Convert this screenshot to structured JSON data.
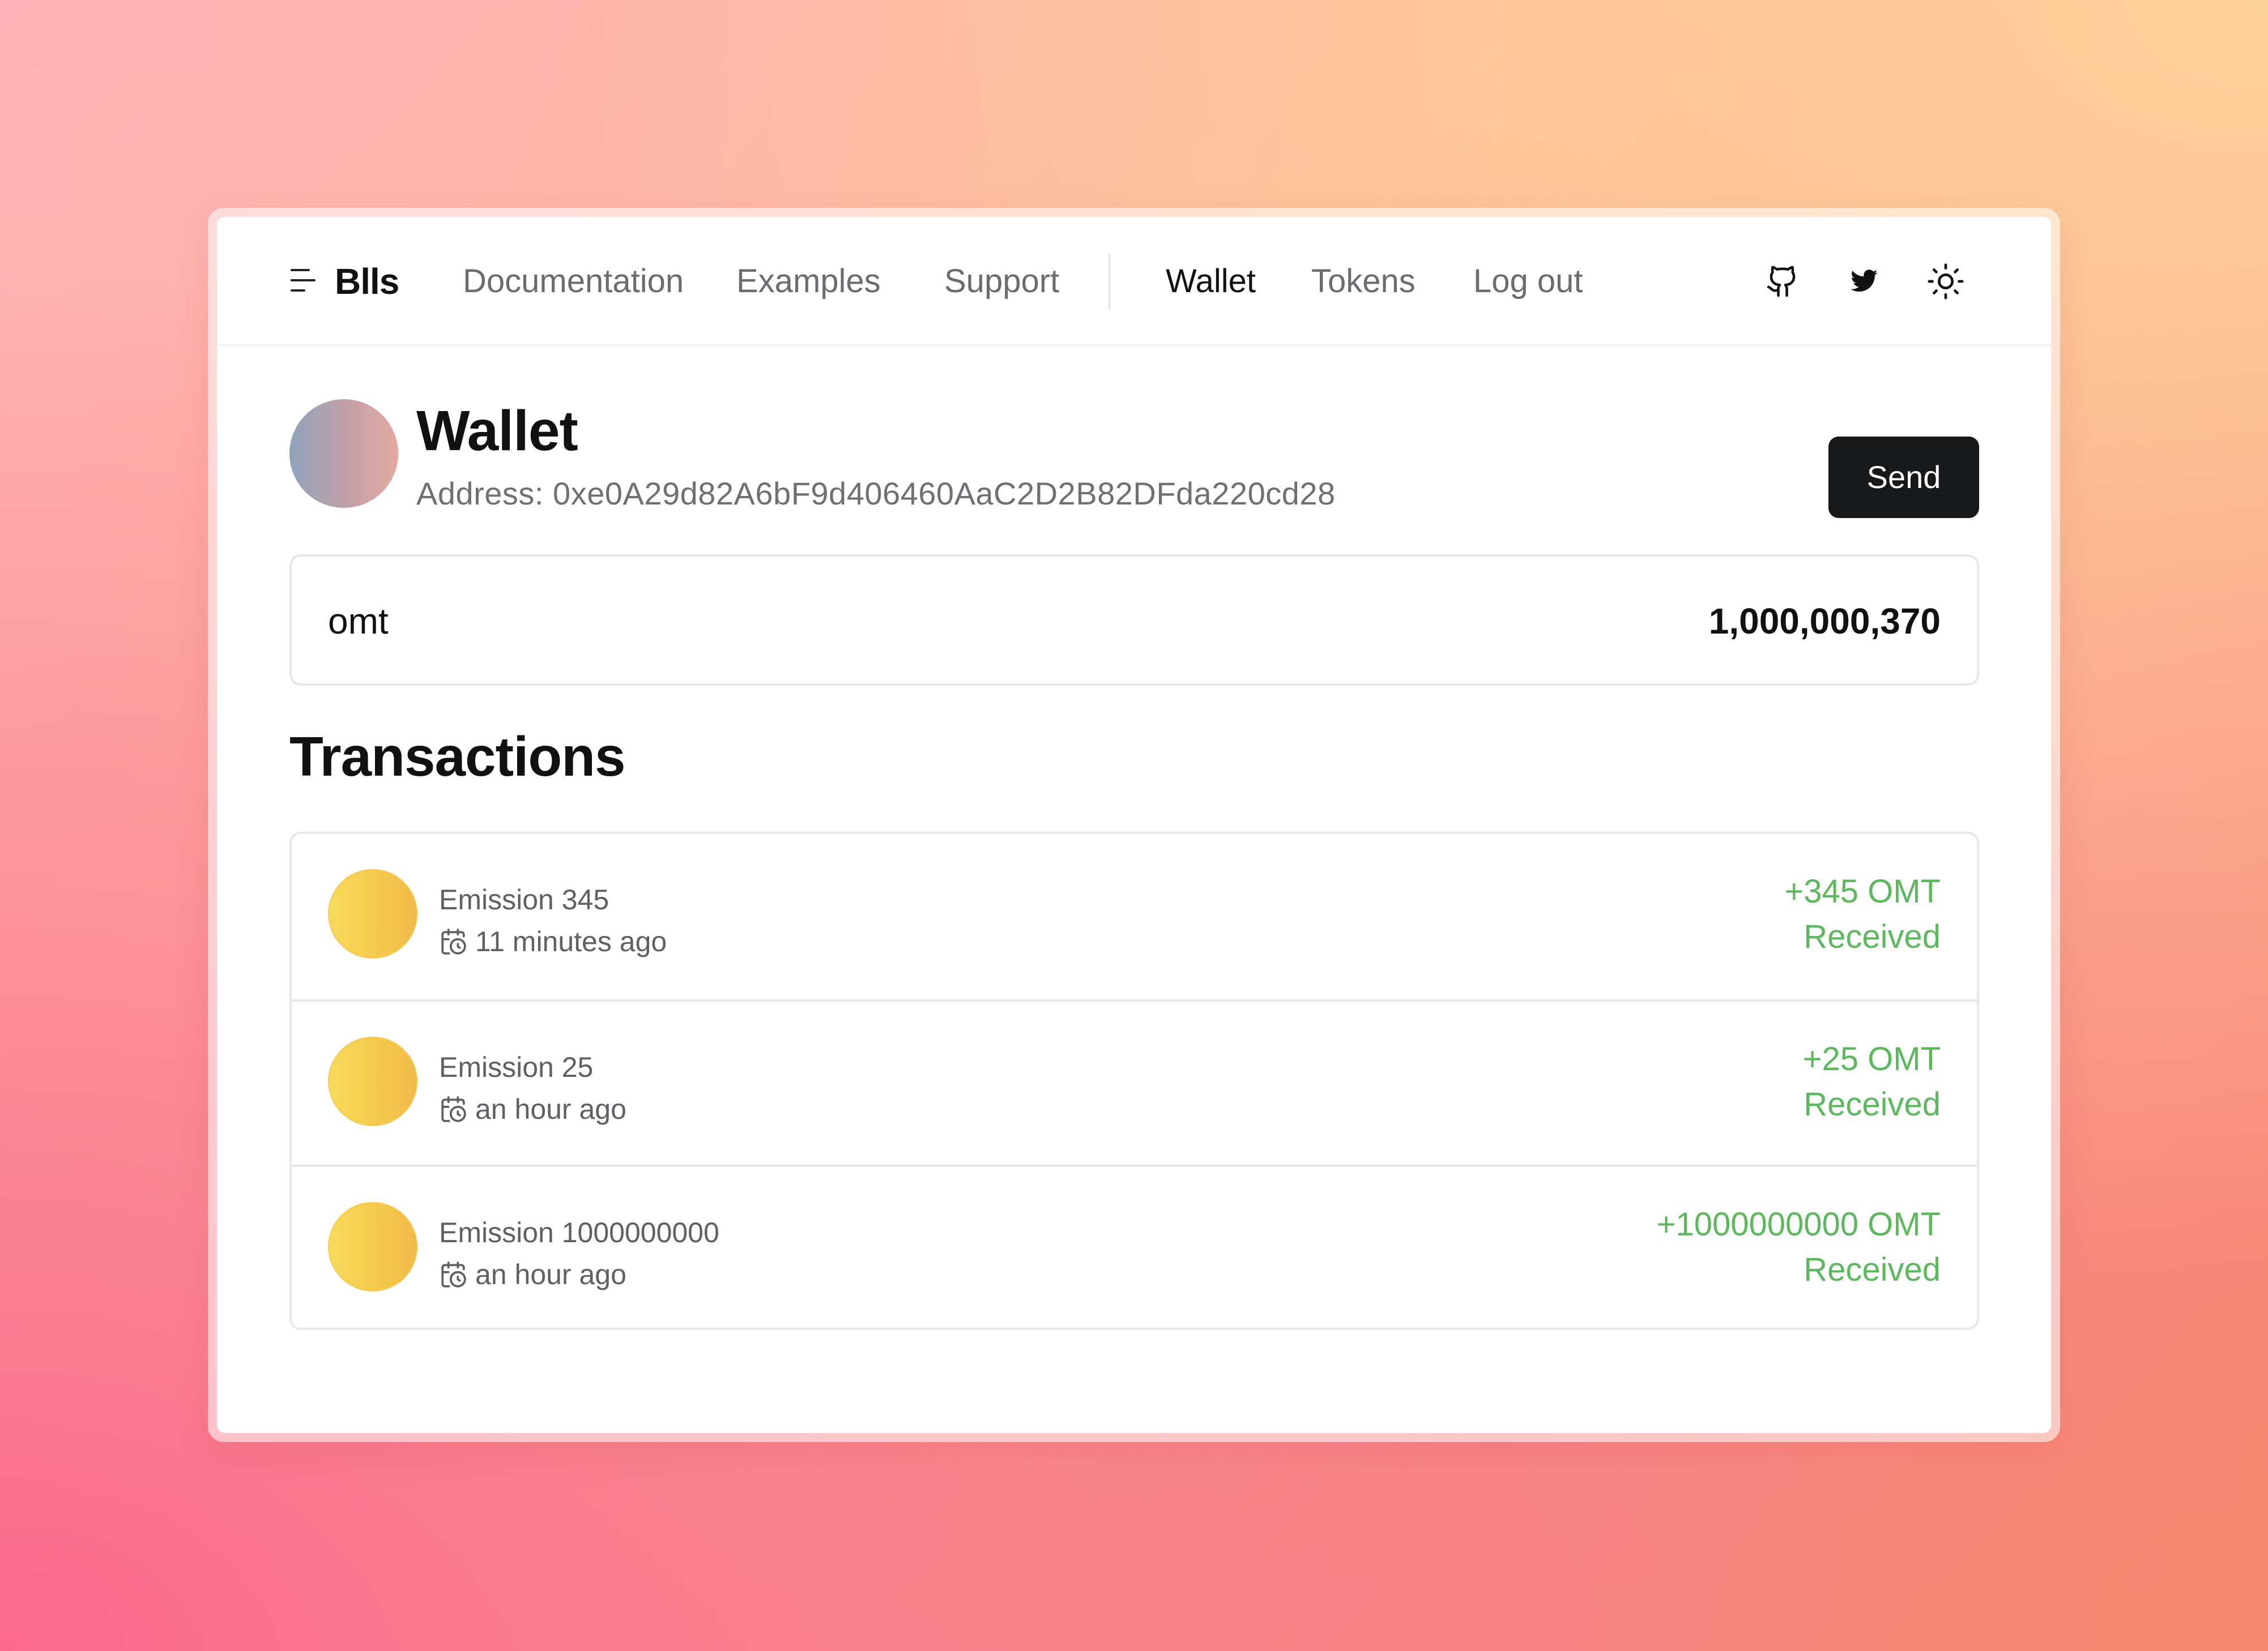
{
  "header": {
    "brand": "Blls",
    "nav_primary": [
      {
        "label": "Documentation"
      },
      {
        "label": "Examples"
      },
      {
        "label": "Support"
      }
    ],
    "nav_secondary": [
      {
        "label": "Wallet",
        "active": true
      },
      {
        "label": "Tokens"
      },
      {
        "label": "Log out"
      }
    ],
    "icons": [
      "github-icon",
      "twitter-icon",
      "sun-icon"
    ]
  },
  "wallet": {
    "title": "Wallet",
    "address": "Address: 0xe0A29d82A6bF9d406460AaC2D2B82DFda220cd28",
    "send_label": "Send",
    "avatar_gradient": [
      "#8fa3bb",
      "#e4a9a0"
    ]
  },
  "balance": {
    "token": "omt",
    "amount": "1,000,000,370"
  },
  "transactions": {
    "heading": "Transactions",
    "items": [
      {
        "name": "Emission 345",
        "time": "11 minutes ago",
        "amount": "+345 OMT",
        "status": "Received"
      },
      {
        "name": "Emission 25",
        "time": "an hour ago",
        "amount": "+25 OMT",
        "status": "Received"
      },
      {
        "name": "Emission 1000000000",
        "time": "an hour ago",
        "amount": "+1000000000 OMT",
        "status": "Received"
      }
    ]
  },
  "colors": {
    "received": "#5cb85c",
    "primary_button": "#17181a",
    "coin": "#f3c44a"
  }
}
